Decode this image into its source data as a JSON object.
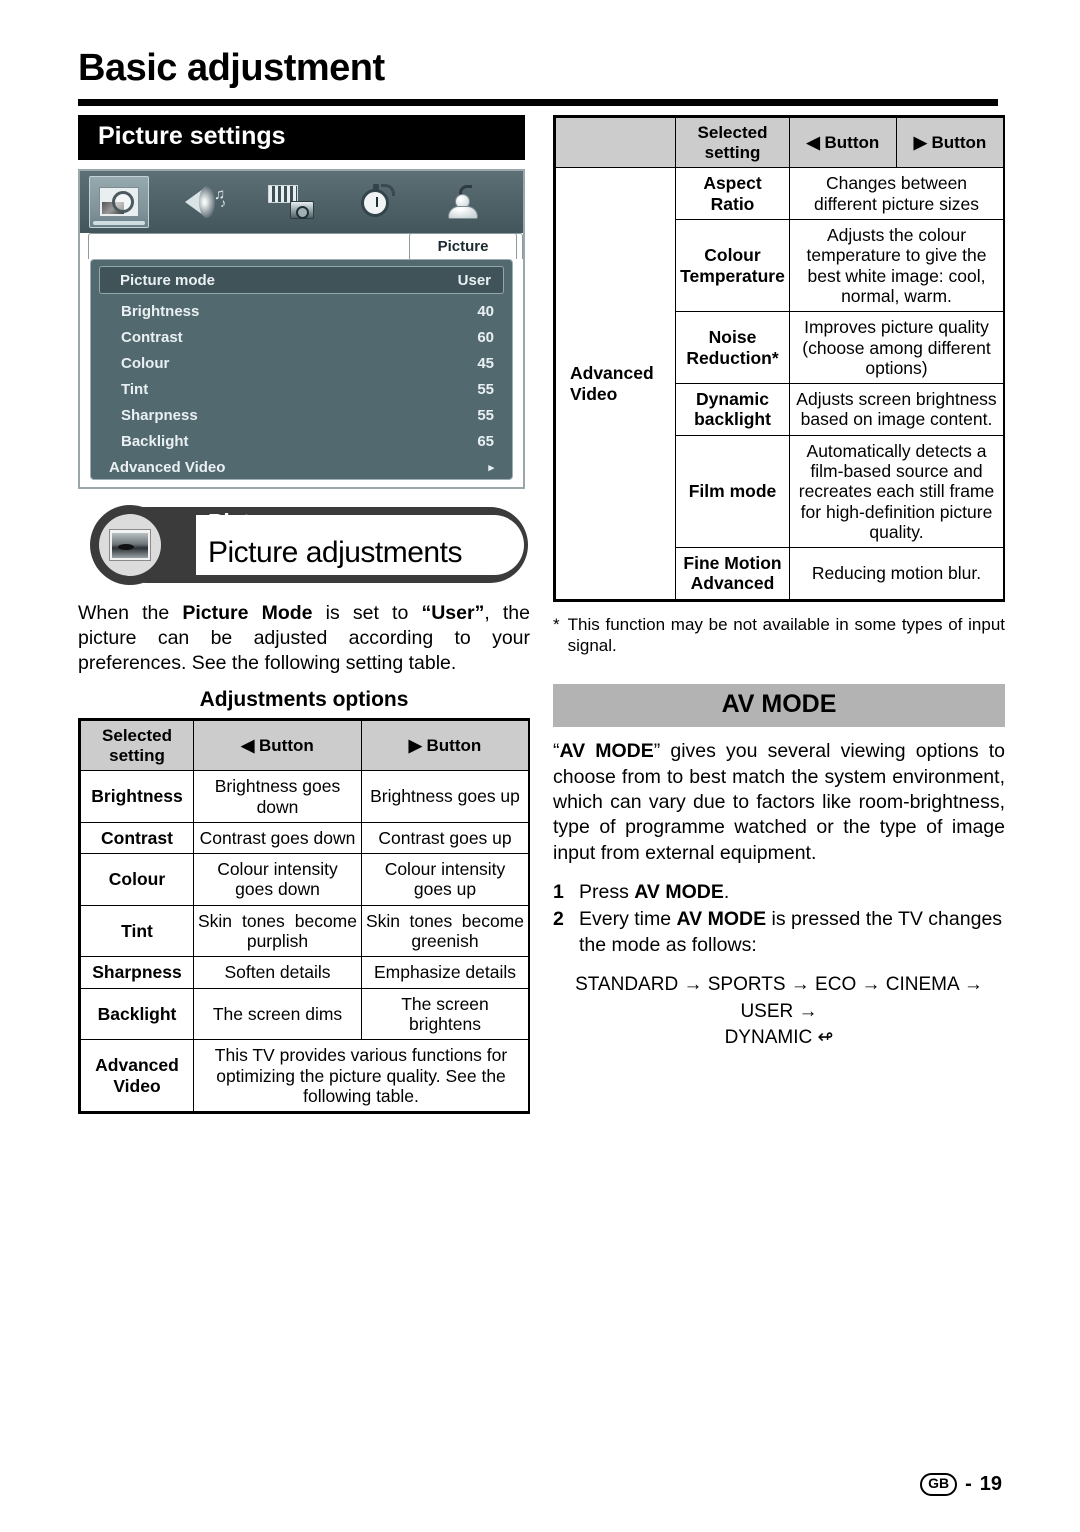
{
  "header": {
    "title": "Basic adjustment"
  },
  "left": {
    "section_bar": "Picture settings",
    "osd": {
      "tab_label": "Picture",
      "rows": [
        {
          "label": "Picture mode",
          "value": "User"
        },
        {
          "label": "Brightness",
          "value": "40"
        },
        {
          "label": "Contrast",
          "value": "60"
        },
        {
          "label": "Colour",
          "value": "45"
        },
        {
          "label": "Tint",
          "value": "55"
        },
        {
          "label": "Sharpness",
          "value": "55"
        },
        {
          "label": "Backlight",
          "value": "65"
        },
        {
          "label": "Advanced Video",
          "value": "▸"
        }
      ]
    },
    "banner": {
      "tag": "Picture",
      "title": "Picture adjustments"
    },
    "body_text_html": "When the <b>Picture Mode</b> is set to <b>“User”</b>, the picture can be adjusted according to your preferences. See the following setting table.",
    "table_heading": "Adjustments options",
    "table": {
      "headers": [
        "Selected setting",
        "◀ Button",
        "▶ Button"
      ],
      "header_col0_line1": "Selected",
      "header_col0_line2": "setting",
      "rows": [
        {
          "setting": "Brightness",
          "left": "Brightness goes down",
          "right": "Brightness goes up"
        },
        {
          "setting": "Contrast",
          "left": "Contrast goes down",
          "right": "Contrast goes up"
        },
        {
          "setting": "Colour",
          "left": "Colour intensity goes down",
          "right": "Colour intensity goes up"
        },
        {
          "setting": "Tint",
          "left": "Skin tones become purplish",
          "right": "Skin tones become greenish"
        },
        {
          "setting": "Sharpness",
          "left": "Soften details",
          "right": "Emphasize details"
        },
        {
          "setting": "Backlight",
          "left": "The screen dims",
          "right": "The screen brightens"
        }
      ],
      "last_row": {
        "setting_line1": "Advanced",
        "setting_line2": "Video",
        "description": "This TV provides various functions for optimizing the picture quality. See the following table."
      }
    }
  },
  "right": {
    "table": {
      "headers": [
        "",
        "Selected setting",
        "◀ Button",
        "▶ Button"
      ],
      "header_col1_line1": "Selected",
      "header_col1_line2": "setting",
      "group_label_line1": "Advanced",
      "group_label_line2": "Video",
      "rows": [
        {
          "setting": "Aspect Ratio",
          "description": "Changes between different picture sizes"
        },
        {
          "setting": "Colour Temperature",
          "description": "Adjusts the colour temperature to give the best white image: cool, normal, warm."
        },
        {
          "setting": "Noise Reduction*",
          "description": "Improves picture quality (choose among different options)"
        },
        {
          "setting": "Dynamic backlight",
          "description": "Adjusts screen brightness based on image content."
        },
        {
          "setting": "Film mode",
          "description": "Automatically detects a film-based source and recreates each still frame for high-definition picture quality."
        },
        {
          "setting": "Fine Motion Advanced",
          "description": "Reducing motion blur."
        }
      ]
    },
    "footnote": {
      "marker": "*",
      "text": "This function may be not available in some types of input signal."
    },
    "av_mode": {
      "bar_title": "AV MODE",
      "paragraph_html": "“<b>AV MODE</b>” gives you several viewing options to choose from to best match the system environment, which can vary due to factors like room-brightness, type of programme watched or the type of image input from external equipment.",
      "steps": [
        {
          "num": "1",
          "text_html": "Press <b>AV MODE</b>."
        },
        {
          "num": "2",
          "text_html": "Every time <b>AV MODE</b> is pressed the TV changes the mode as follows:"
        }
      ],
      "chain_line1": "STANDARD → SPORTS → ECO → CINEMA → USER →",
      "chain_line2": "DYNAMIC ↫"
    }
  },
  "footer": {
    "region_code": "GB",
    "separator": "-",
    "page_number": "19"
  }
}
